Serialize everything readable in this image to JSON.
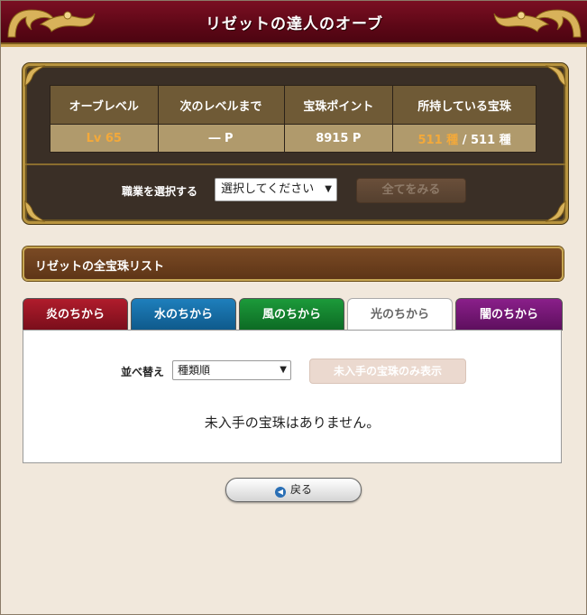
{
  "header": {
    "title": "リゼットの達人のオーブ"
  },
  "stats": {
    "headers": [
      "オーブレベル",
      "次のレベルまで",
      "宝珠ポイント",
      "所持している宝珠"
    ],
    "level": "Lv 65",
    "next_level": "― P",
    "points": "8915 P",
    "owned_count": "511 種",
    "owned_sep": " / ",
    "owned_total": "511 種"
  },
  "job": {
    "label": "職業を選択する",
    "selected": "選択してください",
    "view_all_button": "全てをみる"
  },
  "list": {
    "title": "リゼットの全宝珠リスト"
  },
  "tabs": [
    {
      "label": "炎のちから",
      "color": "#9e1626"
    },
    {
      "label": "水のちから",
      "color": "#1a73aa"
    },
    {
      "label": "風のちから",
      "color": "#178a32"
    },
    {
      "label": "光のちから",
      "color": "#ffffff",
      "active": true
    },
    {
      "label": "闇のちから",
      "color": "#761876"
    }
  ],
  "sort": {
    "label": "並べ替え",
    "selected": "種類順",
    "missing_button": "未入手の宝珠のみ表示"
  },
  "empty_message": "未入手の宝珠はありません。",
  "back_button": {
    "label": "戻る",
    "icon": "back-arrow-icon"
  },
  "colors": {
    "header_bg": "#5c0716",
    "gold": "#c9a24e",
    "orange_text": "#f3a93a"
  }
}
